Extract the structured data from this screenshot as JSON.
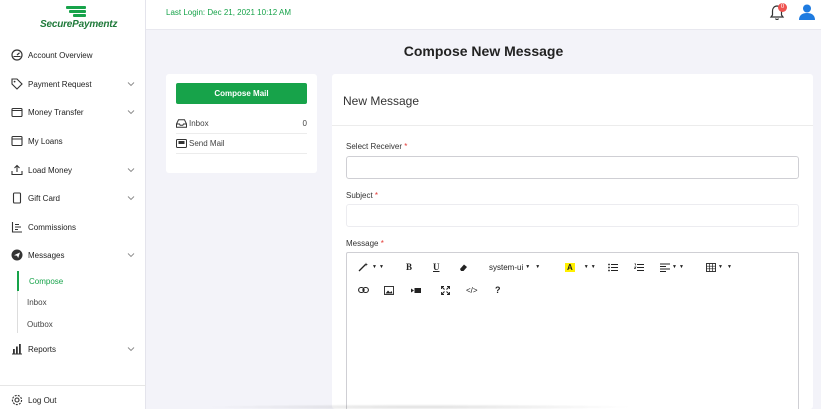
{
  "brand": {
    "name": "SecurePaymentz"
  },
  "topbar": {
    "last_login": "Last Login: Dec 21, 2021 10:12 AM",
    "notification_count": "0"
  },
  "sidebar": {
    "items": [
      {
        "label": "Account Overview",
        "icon": "dashboard-icon",
        "chevron": false
      },
      {
        "label": "Payment Request",
        "icon": "tag-icon",
        "chevron": true
      },
      {
        "label": "Money Transfer",
        "icon": "wallet-icon",
        "chevron": true
      },
      {
        "label": "My Loans",
        "icon": "loan-icon",
        "chevron": false
      },
      {
        "label": "Load Money",
        "icon": "upload-icon",
        "chevron": true
      },
      {
        "label": "Gift Card",
        "icon": "card-icon",
        "chevron": true
      },
      {
        "label": "Commissions",
        "icon": "list-icon",
        "chevron": false
      },
      {
        "label": "Messages",
        "icon": "send-icon",
        "chevron": true
      },
      {
        "label": "Reports",
        "icon": "bar-chart-icon",
        "chevron": true
      }
    ],
    "messages_sub": [
      "Compose",
      "Inbox",
      "Outbox"
    ],
    "logout": "Log Out"
  },
  "page": {
    "title": "Compose New Message"
  },
  "mail_box": {
    "compose_label": "Compose Mail",
    "inbox_label": "Inbox",
    "inbox_count": "0",
    "sent_label": "Send Mail"
  },
  "compose": {
    "heading": "New Message",
    "receiver_label": "Select Receiver",
    "subject_label": "Subject",
    "message_label": "Message",
    "required_mark": "*",
    "font_name": "system-ui"
  },
  "colors": {
    "accent": "#17a34a",
    "badge": "#ef5350",
    "user": "#1e7be0"
  }
}
